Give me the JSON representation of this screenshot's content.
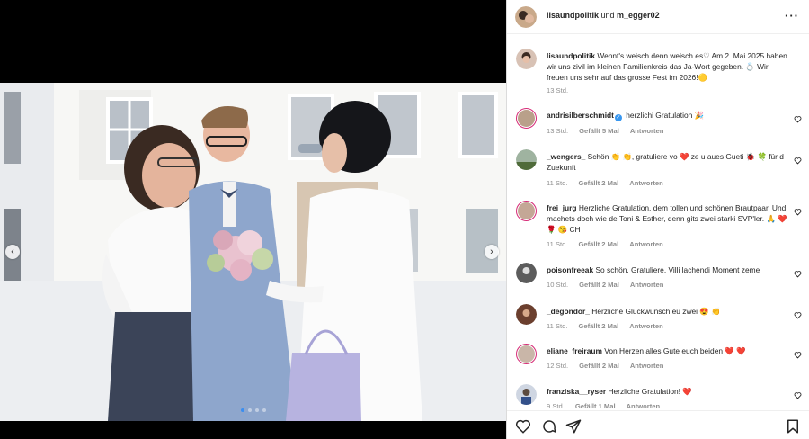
{
  "post": {
    "header_user1": "lisaundpolitik",
    "header_and": " und ",
    "header_user2": "m_egger02",
    "caption_user": "lisaundpolitik",
    "caption_text": "Wennt's weisch denn weisch es♡  Am 2. Mai 2025 haben wir uns zivil im kleinen Familienkreis das Ja-Wort gegeben. 💍 Wir freuen uns sehr auf das grosse Fest im 2026!🟡",
    "caption_time": "13 Std."
  },
  "comments": [
    {
      "user": "andrisilberschmidt",
      "verified": true,
      "text": "herzlichi Gratulation 🎉",
      "time": "13 Std.",
      "likes": "Gefällt 5 Mal",
      "reply": "Antworten"
    },
    {
      "user": "_wengers_",
      "verified": false,
      "text": "Schön 👏 👏, gratuliere vo ❤️ ze u aues Gueti 🐞 🍀 für d Zuekunft",
      "time": "11 Std.",
      "likes": "Gefällt 2 Mal",
      "reply": "Antworten"
    },
    {
      "user": "frei_jurg",
      "verified": false,
      "text": "Herzliche Gratulation, dem tollen und schönen Brautpaar. Und machets doch wie de Toni & Esther, denn gits zwei starki SVP'ler. 🙏 ❤️ 🌹 😘 CH",
      "time": "11 Std.",
      "likes": "Gefällt 2 Mal",
      "reply": "Antworten"
    },
    {
      "user": "poisonfreeak",
      "verified": false,
      "text": "So schön. Gratuliere. Villi lachendi Moment zeme",
      "time": "10 Std.",
      "likes": "Gefällt 2 Mal",
      "reply": "Antworten"
    },
    {
      "user": "_degondor_",
      "verified": false,
      "text": "Herzliche Glückwunsch eu zwei 😍 👏",
      "time": "11 Std.",
      "likes": "Gefällt 2 Mal",
      "reply": "Antworten"
    },
    {
      "user": "eliane_freiraum",
      "verified": false,
      "text": "Von Herzen alles Gute euch beiden ❤️ ❤️",
      "time": "12 Std.",
      "likes": "Gefällt 2 Mal",
      "reply": "Antworten"
    },
    {
      "user": "franziska__ryser",
      "verified": false,
      "text": "Herzliche Gratulation! ❤️",
      "time": "9 Std.",
      "likes": "Gefällt 1 Mal",
      "reply": "Antworten"
    }
  ],
  "carousel": {
    "count": 4,
    "active": 0
  },
  "icons": {
    "more": "more-options-icon",
    "like": "heart-icon",
    "comment": "comment-icon",
    "share": "share-icon",
    "save": "bookmark-icon",
    "prev": "chevron-left-icon",
    "next": "chevron-right-icon"
  },
  "colors": {
    "accent": "#3897f0",
    "story_ring": "#d62976",
    "muted": "#8e8e8e"
  }
}
